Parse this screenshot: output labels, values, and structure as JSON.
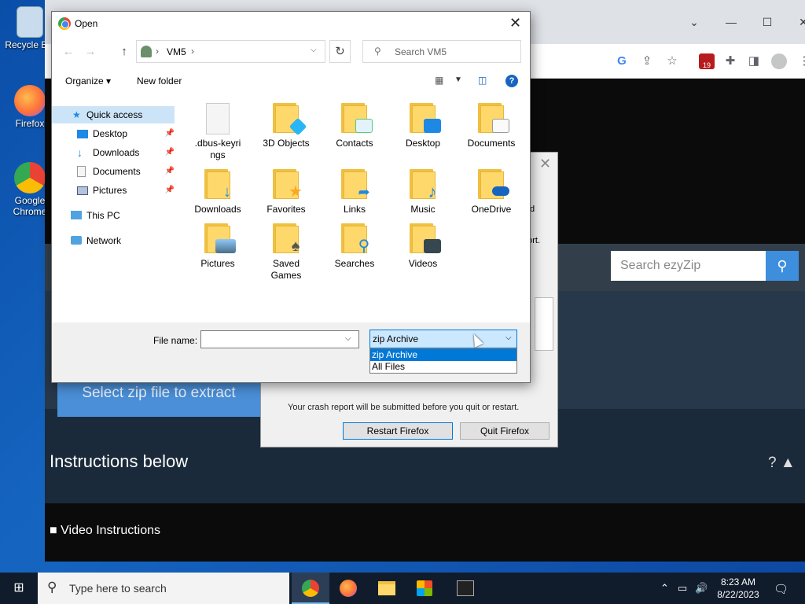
{
  "desktop": {
    "icons": [
      {
        "label": "Recycle Bin"
      },
      {
        "label": "Firefox"
      },
      {
        "label": "Google Chrome"
      }
    ]
  },
  "chrome": {
    "window_controls": [
      "⌄",
      "—",
      "☐",
      "✕"
    ],
    "extension_badge": "19"
  },
  "page": {
    "search_placeholder": "Search ezyZip",
    "select_zip_label": "Select zip file to extract",
    "instructions_heading": "Instructions below",
    "help_label": "? ▲",
    "video_instructions": "Video Instructions"
  },
  "crash_dialog": {
    "fragment1": "d",
    "fragment2": "port.",
    "message": "Your crash report will be submitted before you quit or restart.",
    "restart_label": "Restart Firefox",
    "quit_label": "Quit Firefox"
  },
  "open_dialog": {
    "title": "Open",
    "address": {
      "path": [
        "VM5"
      ]
    },
    "search_placeholder": "Search VM5",
    "organize_label": "Organize",
    "new_folder_label": "New folder",
    "nav": [
      {
        "label": "Quick access",
        "pinned": false
      },
      {
        "label": "Desktop",
        "pinned": true
      },
      {
        "label": "Downloads",
        "pinned": true
      },
      {
        "label": "Documents",
        "pinned": true
      },
      {
        "label": "Pictures",
        "pinned": true
      },
      {
        "label": "This PC",
        "pinned": false
      },
      {
        "label": "Network",
        "pinned": false
      }
    ],
    "items": [
      {
        "label": ".dbus-keyrings",
        "icon": "file-icon"
      },
      {
        "label": "3D Objects",
        "icon": "3d-objects-folder-icon"
      },
      {
        "label": "Contacts",
        "icon": "contacts-folder-icon"
      },
      {
        "label": "Desktop",
        "icon": "desktop-folder-icon"
      },
      {
        "label": "Documents",
        "icon": "documents-folder-icon"
      },
      {
        "label": "Downloads",
        "icon": "downloads-folder-icon"
      },
      {
        "label": "Favorites",
        "icon": "favorites-folder-icon"
      },
      {
        "label": "Links",
        "icon": "links-folder-icon"
      },
      {
        "label": "Music",
        "icon": "music-folder-icon"
      },
      {
        "label": "OneDrive",
        "icon": "onedrive-folder-icon"
      },
      {
        "label": "Pictures",
        "icon": "pictures-folder-icon"
      },
      {
        "label": "Saved Games",
        "icon": "saved-games-folder-icon"
      },
      {
        "label": "Searches",
        "icon": "searches-folder-icon"
      },
      {
        "label": "Videos",
        "icon": "videos-folder-icon"
      }
    ],
    "file_name_label": "File name:",
    "file_name_value": "",
    "file_type_selected": "zip Archive",
    "file_type_options": [
      "zip Archive",
      "All Files"
    ]
  },
  "taskbar": {
    "search_placeholder": "Type here to search",
    "time": "8:23 AM",
    "date": "8/22/2023"
  }
}
